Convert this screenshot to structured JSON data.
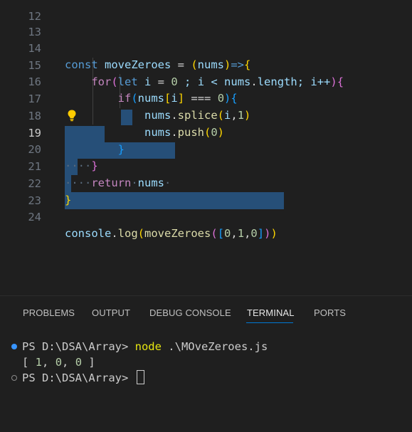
{
  "editor": {
    "line_numbers": [
      "12",
      "13",
      "14",
      "15",
      "16",
      "17",
      "18",
      "19",
      "20",
      "21",
      "22",
      "23",
      "24"
    ],
    "active_line": "19",
    "code": {
      "l14": {
        "kw": "const",
        "name": " moveZeroes ",
        "eq": "= ",
        "p1": "(",
        "param": "nums",
        "p2": ")",
        "arrow": "=>",
        "brace": "{"
      },
      "l15": {
        "indent": "    ",
        "kw": "for",
        "p1": "(",
        "let": "let",
        "rest1": " i ",
        "eq": "=",
        "sp": " ",
        "zero": "0",
        "rest2": " ; i < ",
        "nums": "nums",
        "dot": ".",
        "len": "length",
        "rest3": "; i++",
        "p2": ")",
        "brace": "{"
      },
      "l16": {
        "indent": "        ",
        "kw": "if",
        "p1": "(",
        "nums": "nums",
        "b1": "[",
        "i": "i",
        "b2": "]",
        "rest": " === ",
        "zero": "0",
        "p2": ")",
        "brace": "{"
      },
      "l17": {
        "indent": "            ",
        "obj": "nums",
        "dot": ".",
        "fn": "splice",
        "p1": "(",
        "a": "i",
        "comma": ",",
        "b": "1",
        "p2": ")"
      },
      "l18": {
        "indent": "            ",
        "obj": "nums",
        "dot": ".",
        "fn": "push",
        "p1": "(",
        "a": "0",
        "p2": ")"
      },
      "l19": {
        "indent": "        ",
        "brace": "}"
      },
      "l20": {
        "ws": "····",
        "brace": "}"
      },
      "l21": {
        "ws": "····",
        "kw": "return",
        "ws2": "·",
        "var": "nums",
        "ws3": "·"
      },
      "l22": {
        "brace": "}"
      },
      "l24": {
        "obj": "console",
        "dot": ".",
        "fn": "log",
        "p1": "(",
        "fn2": "moveZeroes",
        "p2": "(",
        "b1": "[",
        "a": "0",
        "c1": ",",
        "b": "1",
        "c2": ",",
        "c": "0",
        "b2": "]",
        "p3": ")",
        "p4": ")"
      }
    }
  },
  "panel": {
    "tabs": [
      "PROBLEMS",
      "OUTPUT",
      "DEBUG CONSOLE",
      "TERMINAL",
      "PORTS"
    ],
    "active_tab": "TERMINAL"
  },
  "terminal": {
    "line1_prompt": "PS D:\\DSA\\Array> ",
    "line1_cmd": "node",
    "line1_arg": " .\\MOveZeroes.js",
    "line2_open": "[ ",
    "line2_v1": "1",
    "line2_c1": ", ",
    "line2_v2": "0",
    "line2_c2": ", ",
    "line2_v3": "0",
    "line2_close": " ]",
    "line3_prompt": "PS D:\\DSA\\Array> "
  },
  "colors": {
    "background": "#1f1f1f",
    "selection": "#264f78",
    "tab_underline": "#0078d4",
    "command": "#e5e510"
  },
  "icons": [
    "lightbulb-icon",
    "terminal-status-dot-icon",
    "terminal-prompt-circle-icon"
  ]
}
